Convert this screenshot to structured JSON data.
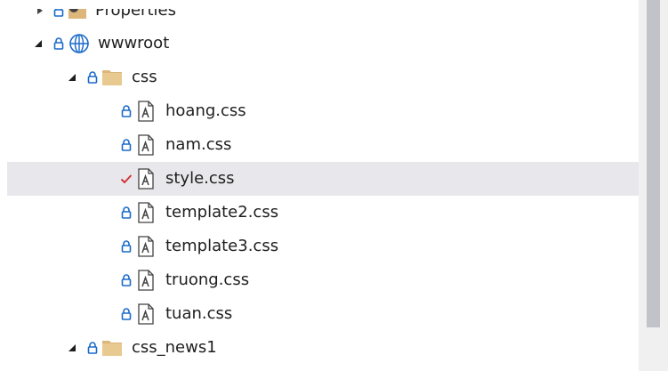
{
  "tree": {
    "items": [
      {
        "label": "Properties",
        "state": "collapsed",
        "status": "locked",
        "icon": "wrench-folder-icon"
      },
      {
        "label": "wwwroot",
        "state": "expanded",
        "status": "locked",
        "icon": "globe-icon"
      },
      {
        "label": "css",
        "state": "expanded",
        "status": "locked",
        "icon": "folder-icon"
      },
      {
        "label": "hoang.css",
        "status": "locked",
        "icon": "css-file-icon"
      },
      {
        "label": "nam.css",
        "status": "locked",
        "icon": "css-file-icon"
      },
      {
        "label": "style.css",
        "status": "checked-out",
        "icon": "css-file-icon",
        "selected": true
      },
      {
        "label": "template2.css",
        "status": "locked",
        "icon": "css-file-icon"
      },
      {
        "label": "template3.css",
        "status": "locked",
        "icon": "css-file-icon"
      },
      {
        "label": "truong.css",
        "status": "locked",
        "icon": "css-file-icon"
      },
      {
        "label": "tuan.css",
        "status": "locked",
        "icon": "css-file-icon"
      },
      {
        "label": "css_news1",
        "state": "expanded",
        "status": "locked",
        "icon": "folder-icon"
      }
    ]
  },
  "colors": {
    "lock": "#1b6ac9",
    "check": "#d13438",
    "folder": "#dcb67a",
    "globe": "#1b6ac9",
    "selected_bg": "#e8e8ec",
    "scroll_thumb": "#c2c3c9"
  }
}
